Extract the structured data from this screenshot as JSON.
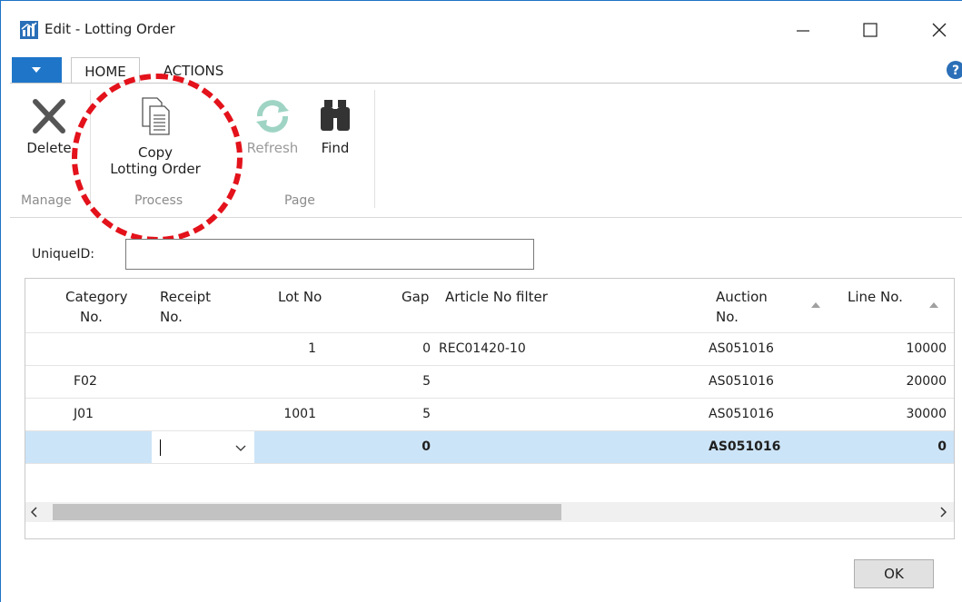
{
  "window": {
    "title": "Edit - Lotting Order",
    "controls": {
      "minimize": "minimize-icon",
      "maximize": "maximize-icon",
      "close": "close-icon"
    }
  },
  "ribbon": {
    "tabs": [
      {
        "label": "HOME"
      },
      {
        "label": "ACTIONS"
      }
    ],
    "buttons": {
      "delete": "Delete",
      "copy_line1": "Copy",
      "copy_line2": "Lotting Order",
      "refresh": "Refresh",
      "find": "Find"
    },
    "groups": {
      "manage": "Manage",
      "process": "Process",
      "page": "Page"
    }
  },
  "form": {
    "unique_id_label": "UniqueID:",
    "unique_id_value": ""
  },
  "grid": {
    "columns": {
      "category_1": "Category",
      "category_2": "No.",
      "receipt_1": "Receipt",
      "receipt_2": "No.",
      "lot_no": "Lot No",
      "gap": "Gap",
      "article": "Article No filter",
      "auction_1": "Auction",
      "auction_2": "No.",
      "line_no": "Line No."
    },
    "rows": [
      {
        "category": "",
        "receipt": "",
        "lot_no": "1",
        "gap": "0",
        "article": "REC01420-10",
        "auction": "AS051016",
        "line_no": "10000"
      },
      {
        "category": "F02",
        "receipt": "",
        "lot_no": "",
        "gap": "5",
        "article": "",
        "auction": "AS051016",
        "line_no": "20000"
      },
      {
        "category": "J01",
        "receipt": "",
        "lot_no": "1001",
        "gap": "5",
        "article": "",
        "auction": "AS051016",
        "line_no": "30000"
      },
      {
        "category": "",
        "receipt": "",
        "lot_no": "",
        "gap": "0",
        "article": "",
        "auction": "AS051016",
        "line_no": "0"
      }
    ]
  },
  "footer": {
    "ok_label": "OK"
  },
  "colors": {
    "accent": "#1f76c9",
    "selection": "#cce4f7",
    "callout": "#e3121b"
  }
}
